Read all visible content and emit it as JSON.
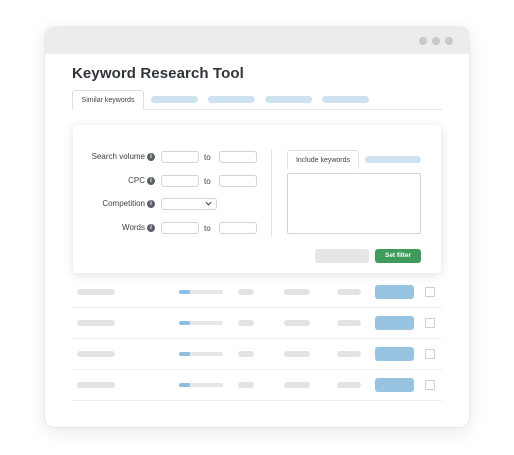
{
  "window": {
    "title": "Keyword Research Tool",
    "controls": [
      "dot-icon",
      "dot-icon",
      "dot-icon"
    ]
  },
  "tabs": {
    "active_label": "Similar keywords"
  },
  "filters": {
    "search_volume": {
      "label": "Search volume",
      "separator": "to",
      "from": "",
      "to": ""
    },
    "cpc": {
      "label": "CPC",
      "separator": "to",
      "from": "",
      "to": ""
    },
    "competition": {
      "label": "Competition",
      "selected": ""
    },
    "words": {
      "label": "Words",
      "separator": "to",
      "from": "",
      "to": ""
    },
    "info_icon": "i",
    "include_tab_label": "Include keywords",
    "include_text": "",
    "set_filter_label": "Set filter"
  },
  "results": {
    "rows": [
      {
        "volume_fraction": 0.25,
        "checked": false
      },
      {
        "volume_fraction": 0.25,
        "checked": false
      },
      {
        "volume_fraction": 0.25,
        "checked": false
      },
      {
        "volume_fraction": 0.25,
        "checked": false
      }
    ]
  },
  "colors": {
    "accent_blue": "#98c3e1",
    "placeholder_blue": "#cfe2ef",
    "set_filter_green": "#3f9b5a"
  }
}
